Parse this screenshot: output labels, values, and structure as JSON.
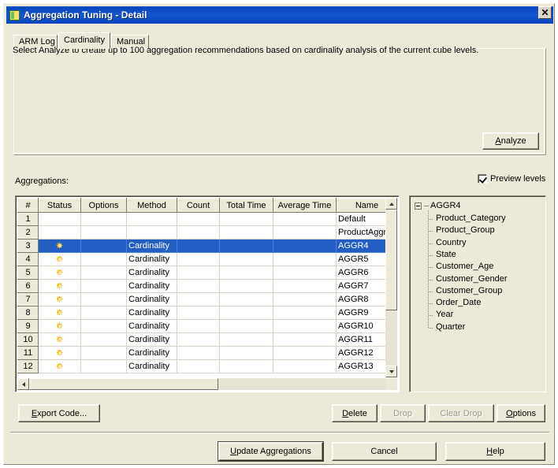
{
  "window": {
    "title": "Aggregation Tuning - Detail",
    "icon": "application-window-icon",
    "close_label": "✕"
  },
  "tabs": [
    {
      "label": "ARM Log",
      "selected": false
    },
    {
      "label": "Cardinality",
      "selected": true
    },
    {
      "label": "Manual",
      "selected": false
    }
  ],
  "description": {
    "text": "Select Analyze to create up to 100 aggregation recommendations based on cardinality analysis of the current cube levels."
  },
  "analyze": {
    "label": "Analyze",
    "accel": "A"
  },
  "aggregations": {
    "label": "Aggregations:",
    "preview_checkbox": {
      "label": "Preview levels",
      "checked": true
    },
    "columns": [
      "#",
      "Status",
      "Options",
      "Method",
      "Count",
      "Total Time",
      "Average Time",
      "Name"
    ],
    "rows": [
      {
        "num": "1",
        "status": "",
        "options": "",
        "method": "",
        "count": "",
        "total_time": "",
        "average_time": "",
        "name": "Default",
        "selected": false
      },
      {
        "num": "2",
        "status": "",
        "options": "",
        "method": "",
        "count": "",
        "total_time": "",
        "average_time": "",
        "name": "ProductAggre",
        "selected": false
      },
      {
        "num": "3",
        "status": "sun",
        "options": "",
        "method": "Cardinality",
        "count": "",
        "total_time": "",
        "average_time": "",
        "name": "AGGR4",
        "selected": true
      },
      {
        "num": "4",
        "status": "sun",
        "options": "",
        "method": "Cardinality",
        "count": "",
        "total_time": "",
        "average_time": "",
        "name": "AGGR5",
        "selected": false
      },
      {
        "num": "5",
        "status": "sun",
        "options": "",
        "method": "Cardinality",
        "count": "",
        "total_time": "",
        "average_time": "",
        "name": "AGGR6",
        "selected": false
      },
      {
        "num": "6",
        "status": "sun",
        "options": "",
        "method": "Cardinality",
        "count": "",
        "total_time": "",
        "average_time": "",
        "name": "AGGR7",
        "selected": false
      },
      {
        "num": "7",
        "status": "sun",
        "options": "",
        "method": "Cardinality",
        "count": "",
        "total_time": "",
        "average_time": "",
        "name": "AGGR8",
        "selected": false
      },
      {
        "num": "8",
        "status": "sun",
        "options": "",
        "method": "Cardinality",
        "count": "",
        "total_time": "",
        "average_time": "",
        "name": "AGGR9",
        "selected": false
      },
      {
        "num": "9",
        "status": "sun",
        "options": "",
        "method": "Cardinality",
        "count": "",
        "total_time": "",
        "average_time": "",
        "name": "AGGR10",
        "selected": false
      },
      {
        "num": "10",
        "status": "sun",
        "options": "",
        "method": "Cardinality",
        "count": "",
        "total_time": "",
        "average_time": "",
        "name": "AGGR11",
        "selected": false
      },
      {
        "num": "11",
        "status": "sun",
        "options": "",
        "method": "Cardinality",
        "count": "",
        "total_time": "",
        "average_time": "",
        "name": "AGGR12",
        "selected": false
      },
      {
        "num": "12",
        "status": "sun",
        "options": "",
        "method": "Cardinality",
        "count": "",
        "total_time": "",
        "average_time": "",
        "name": "AGGR13",
        "selected": false
      }
    ]
  },
  "tree": {
    "root": "AGGR4",
    "expanded": true,
    "children": [
      "Product_Category",
      "Product_Group",
      "Country",
      "State",
      "Customer_Age",
      "Customer_Gender",
      "Customer_Group",
      "Order_Date",
      "Year",
      "Quarter"
    ]
  },
  "toolbar": {
    "export_label": "Export Code...",
    "export_accel": "E",
    "delete_label": "Delete",
    "delete_accel": "D",
    "drop_label": "Drop",
    "drop_enabled": false,
    "clear_drop_label": "Clear Drop",
    "clear_drop_enabled": false,
    "options_label": "Options",
    "options_accel": "O"
  },
  "footer": {
    "update_label": "Update Aggregations",
    "update_accel": "U",
    "cancel_label": "Cancel",
    "help_label": "Help",
    "help_accel": "H"
  },
  "colors": {
    "titlebar": "#0a46bd",
    "dialog_face": "#ece9d8",
    "selection": "#225ec4",
    "status_icon": "#f2b316"
  }
}
